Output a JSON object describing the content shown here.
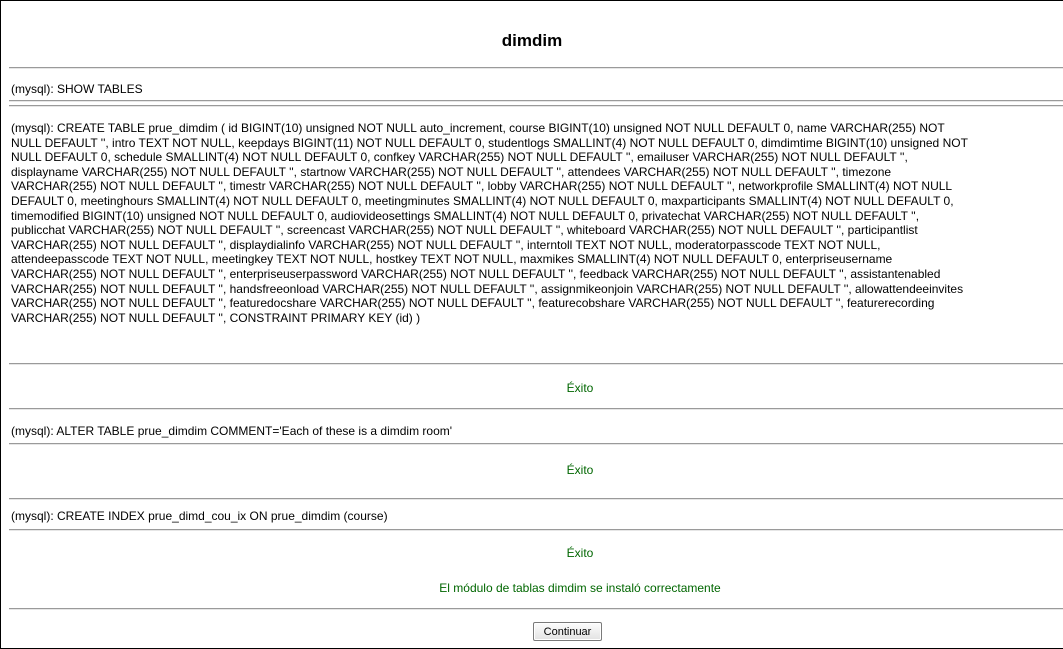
{
  "page": {
    "title": "dimdim"
  },
  "queries": {
    "show_tables": "(mysql): SHOW TABLES",
    "create_table_lines": [
      "(mysql): CREATE TABLE prue_dimdim ( id BIGINT(10) unsigned NOT NULL auto_increment, course BIGINT(10) unsigned NOT NULL DEFAULT 0, name VARCHAR(255) NOT",
      "NULL DEFAULT '', intro TEXT NOT NULL, keepdays BIGINT(11) NOT NULL DEFAULT 0, studentlogs SMALLINT(4) NOT NULL DEFAULT 0, dimdimtime BIGINT(10) unsigned NOT",
      "NULL DEFAULT 0, schedule SMALLINT(4) NOT NULL DEFAULT 0, confkey VARCHAR(255) NOT NULL DEFAULT '', emailuser VARCHAR(255) NOT NULL DEFAULT '',",
      "displayname VARCHAR(255) NOT NULL DEFAULT '', startnow VARCHAR(255) NOT NULL DEFAULT '', attendees VARCHAR(255) NOT NULL DEFAULT '', timezone",
      "VARCHAR(255) NOT NULL DEFAULT '', timestr VARCHAR(255) NOT NULL DEFAULT '', lobby VARCHAR(255) NOT NULL DEFAULT '', networkprofile SMALLINT(4) NOT NULL",
      "DEFAULT 0, meetinghours SMALLINT(4) NOT NULL DEFAULT 0, meetingminutes SMALLINT(4) NOT NULL DEFAULT 0, maxparticipants SMALLINT(4) NOT NULL DEFAULT 0,",
      "timemodified BIGINT(10) unsigned NOT NULL DEFAULT 0, audiovideosettings SMALLINT(4) NOT NULL DEFAULT 0, privatechat VARCHAR(255) NOT NULL DEFAULT '',",
      "publicchat VARCHAR(255) NOT NULL DEFAULT '', screencast VARCHAR(255) NOT NULL DEFAULT '', whiteboard VARCHAR(255) NOT NULL DEFAULT '', participantlist",
      "VARCHAR(255) NOT NULL DEFAULT '', displaydialinfo VARCHAR(255) NOT NULL DEFAULT '', interntoll TEXT NOT NULL, moderatorpasscode TEXT NOT NULL,",
      "attendeepasscode TEXT NOT NULL, meetingkey TEXT NOT NULL, hostkey TEXT NOT NULL, maxmikes SMALLINT(4) NOT NULL DEFAULT 0, enterpriseusername",
      "VARCHAR(255) NOT NULL DEFAULT '', enterpriseuserpassword VARCHAR(255) NOT NULL DEFAULT '', feedback VARCHAR(255) NOT NULL DEFAULT '', assistantenabled",
      "VARCHAR(255) NOT NULL DEFAULT '', handsfreeonload VARCHAR(255) NOT NULL DEFAULT '', assignmikeonjoin VARCHAR(255) NOT NULL DEFAULT '', allowattendeeinvites",
      "VARCHAR(255) NOT NULL DEFAULT '', featuredocshare VARCHAR(255) NOT NULL DEFAULT '', featurecobshare VARCHAR(255) NOT NULL DEFAULT '', featurerecording",
      "VARCHAR(255) NOT NULL DEFAULT '', CONSTRAINT PRIMARY KEY (id) )"
    ],
    "alter_table": "(mysql): ALTER TABLE prue_dimdim COMMENT='Each of these is a dimdim room'",
    "create_index": "(mysql): CREATE INDEX prue_dimd_cou_ix ON prue_dimdim (course)"
  },
  "results": {
    "success_1": "Éxito",
    "success_2": "Éxito",
    "success_3": "Éxito"
  },
  "final_message": "El módulo de tablas dimdim se instaló correctamente",
  "continue_button": "Continuar",
  "colors": {
    "success_text": "#006600",
    "rule": "#9a9a9a"
  }
}
